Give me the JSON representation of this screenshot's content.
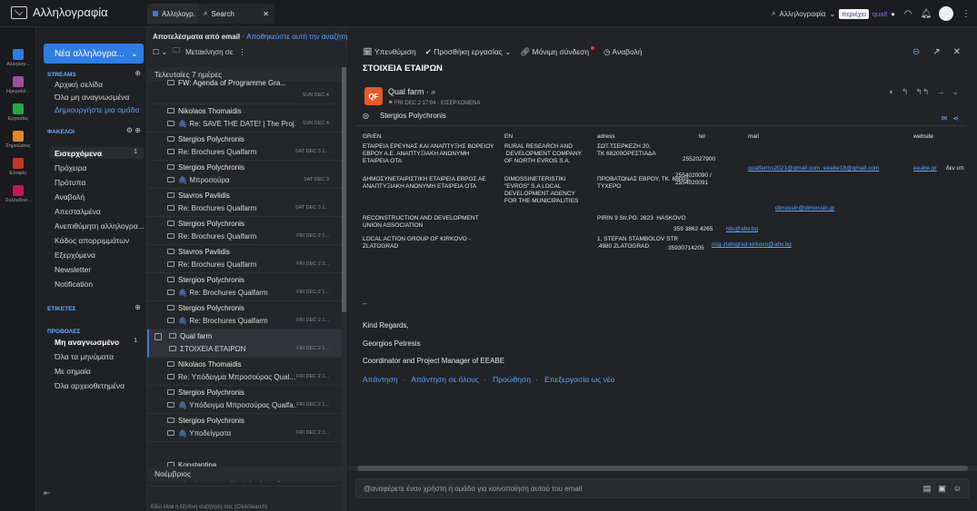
{
  "app": {
    "title": "Αλληλογραφία"
  },
  "tabs": [
    {
      "label": "Αλληλογρ."
    },
    {
      "label": "Search"
    }
  ],
  "topbar": {
    "search_label": "Αλληλογραφία",
    "search_chip": "περιέχει",
    "search_value": "qualf"
  },
  "rail": [
    {
      "label": "Αλληλογ...",
      "color": "#2f7de1"
    },
    {
      "label": "Ημερολό...",
      "color": "#a04ea0"
    },
    {
      "label": "Εργασίες",
      "color": "#28a745"
    },
    {
      "label": "Σημειώσεις",
      "color": "#e2872c"
    },
    {
      "label": "Επαφές",
      "color": "#c0392b"
    },
    {
      "label": "Συλλοδοσ...",
      "color": "#c2185b"
    }
  ],
  "sidebar": {
    "new_button": "Νέα αλληλογρα...",
    "streams_title": "STREAMS",
    "streams": [
      {
        "label": "Αρχική σελίδα"
      },
      {
        "label": "Όλα μη αναγνωσμένα"
      },
      {
        "label": "Δημιουργήστε μια ομάδα"
      }
    ],
    "folders_title": "ΦΑΚΕΛΟΙ",
    "folders": [
      {
        "label": "Εισερχόμενα",
        "count": "1"
      },
      {
        "label": "Πρόχειρα"
      },
      {
        "label": "Πρότυπα"
      },
      {
        "label": "Αναβολή"
      },
      {
        "label": "Απεσταλμένα"
      },
      {
        "label": "Ανεπιθύμητη αλληλογρα..."
      },
      {
        "label": "Κάδος απορριμμάτων"
      },
      {
        "label": "Εξερχόμενα"
      },
      {
        "label": "Newsletter"
      },
      {
        "label": "Notification"
      }
    ],
    "tags_title": "ΕΤΙΚΕΤΕΣ",
    "views_title": "ΠΡΟΒΟΛΕΣ",
    "views": [
      {
        "label": "Μη αναγνωσμένο",
        "count": "1"
      },
      {
        "label": "Όλα τα μηνύματα"
      },
      {
        "label": "Με σημαία"
      },
      {
        "label": "Όλα αρχειοθετημένα"
      }
    ]
  },
  "list": {
    "header": "Αποτελέσματα από email",
    "header_hint": "· Αποθηκεύστε αυτή την αναζήτηση",
    "move_label": "Μετακίνηση σε",
    "groups": [
      {
        "label": "Τελευταίες 7 ημέρες"
      },
      {
        "label": "Νοέμβριος"
      }
    ],
    "messages": [
      {
        "from": "FW: Agenda of Programme Gra...",
        "subject": "",
        "date": "SUN DEC 4"
      },
      {
        "from": "Nikolaos Thomaidis",
        "subject": "Re: SAVE THE DATE! | The Proj...",
        "date": "SUN DEC 4"
      },
      {
        "from": "Stergios Polychronis",
        "subject": "Re: Brochures Qualfarm",
        "date": "SAT DEC 3 1..."
      },
      {
        "from": "Stergios Polychronis",
        "subject": "Μπροσούρα",
        "date": "SAT DEC 3"
      },
      {
        "from": "Stavros Pavlidis",
        "subject": "Re: Brochures Qualfarm",
        "date": "SAT DEC 3 1..."
      },
      {
        "from": "Stergios Polychronis",
        "subject": "Re: Brochures Qualfarm",
        "date": "FRI DEC 2 1..."
      },
      {
        "from": "Stavros Pavlidis",
        "subject": "Re: Brochures Qualfarm",
        "date": "FRI DEC 2 2..."
      },
      {
        "from": "Stergios Polychronis",
        "subject": "Re: Brochures Qualfarm",
        "date": "FRI DEC 2 1..."
      },
      {
        "from": "Stergios Polychronis",
        "subject": "Re: Brochures Qualfarm",
        "date": "FRI DEC 2 1..."
      },
      {
        "from": "Qual farm",
        "subject": "ΣΤΟΙΧΕΙΑ ΕΤΑΙΡΩΝ",
        "date": "FRI DEC 2 1..."
      },
      {
        "from": "Nikolaos Thomaidis",
        "subject": "Re: Υπόδειγμα Μπροσούρας Qual...",
        "date": "FRI DEC 2 1..."
      },
      {
        "from": "Stergios Polychronis",
        "subject": "Υπόδειγμα Μπροσούρας Qualfa...",
        "date": "FRI DEC 2 1..."
      },
      {
        "from": "Stergios Polychronis",
        "subject": "Υποδείγματα",
        "date": "FRI DEC 2 1..."
      },
      {
        "from": "Konstantina",
        "subject": "Προώθ.: Οδηγός αρωγών Qua...",
        "date": "WED NOV 9"
      }
    ],
    "footer": "Εδώ είναι η έξυπνη συζήτηση σας (ClickSearch)"
  },
  "pane": {
    "tools": [
      "Υπενθύμιση",
      "Προσθήκη εργασίας",
      "Μόνιμη σύνδεση",
      "Αναβολή"
    ],
    "title": "ΣΤΟΙΧΕΙΑ ΕΤΑΙΡΩΝ",
    "sender": "Qual farm",
    "sender_initials": "QF",
    "meta": "FRI DEC 2 17:04 · ΕΙΣΕΡΧΟΜΕΝΑ",
    "to": "Stergios Polychronis",
    "table_headers": [
      "GR/EN",
      "EN",
      "adress",
      "tel",
      "mail",
      "website"
    ],
    "rows": {
      "r1c1": "ΕΤΑΙΡΕΙΑ ΕΡΕΥΝΑΣ ΚΑΙ ΑΝΑΠΤΥΞΗΣ ΒΟΡΕΙΟΥ\nΕΒΡΟΥ Α.Ε. ΑΝΑΠΤΥΞΙΑΚΗ ΑΝΩΝΥΜΗ\nΕΤΑΙΡΕΙΑ ΟΤΑ",
      "r1c2": "RURAL RESEARCH AND\n DEVELOPMENT COMPANY\nOF NORTH EVROS S.A.",
      "r1c3": "ΣΩΤ.ΤΣΕΡΚΕΖΗ 20,\nΤΚ 68200ΟΡΕΣΤΙΑΔΑ",
      "r1c4": "2552027900",
      "r1c5": "qualfarms2021@gmail.com  eeabe18@gmail.com",
      "r1c6": "eeabe.gr",
      "r1c6b": "δεν υπ",
      "r2c1": "ΔΗΜΟΣΥΝΕΤΑΙΡΙΣΤΙΚΗ ΕΤΑΙΡΕΙΑ ΕΒΡΟΣ ΑΕ\nΑΝΑΠΤΥΞΙΑΚΗ ΑΝΩΝΥΜΗ ΕΤΑΙΡΕΙΑ ΟΤΑ",
      "r2c2": "DIMOSSINETERISTIKI\n\"EVROS\" S.A LOCAL\nDEVELOPMENT AGENCY\nFOR THE MUNICIPALITIES",
      "r2c3": "ΠΡΟΒΑΤΩΝΑΣ ΕΒΡΟΥ, ΤΚ. 68003,\nΤΥΧΕΡΟ",
      "r2c4": "2554020090 /\n2554020091",
      "r2c5": "dimossin@dimossin.gr",
      "r3c1": "RECONSTRUCTION AND DEVELOPMENT\nUNION ASSOCIATION",
      "r3c3": "PIRIN 9 Str,PO. 2823  HASKOVO",
      "r3c4": "359 3862 4265",
      "r3c5": "rdu@abv.bg",
      "r4c1": "LOCAL ACTION GROUP OF KIRKOVO -\nZLATOGRAD",
      "r4c3": "1, STEFAN STAMBOLOV STR\n.4980 ZLATOGRAD",
      "r4c4": "35930714205",
      "r4c5": "mig-zlatograd-kirkovo@abv.bg"
    },
    "dashes": "--",
    "signature": [
      "Kind Regards,",
      "Georgios Petresis",
      "Coordinator and Project Manager of EEABE"
    ],
    "actions": [
      "Απάντηση",
      "Απάντηση σε όλους",
      "Προώθηση",
      "Επεξεργασία ως νέο"
    ],
    "compose_placeholder": "@αναφέρετε έναν χρήστη ή ομάδα για κοινοποίηση αυτού του email"
  }
}
